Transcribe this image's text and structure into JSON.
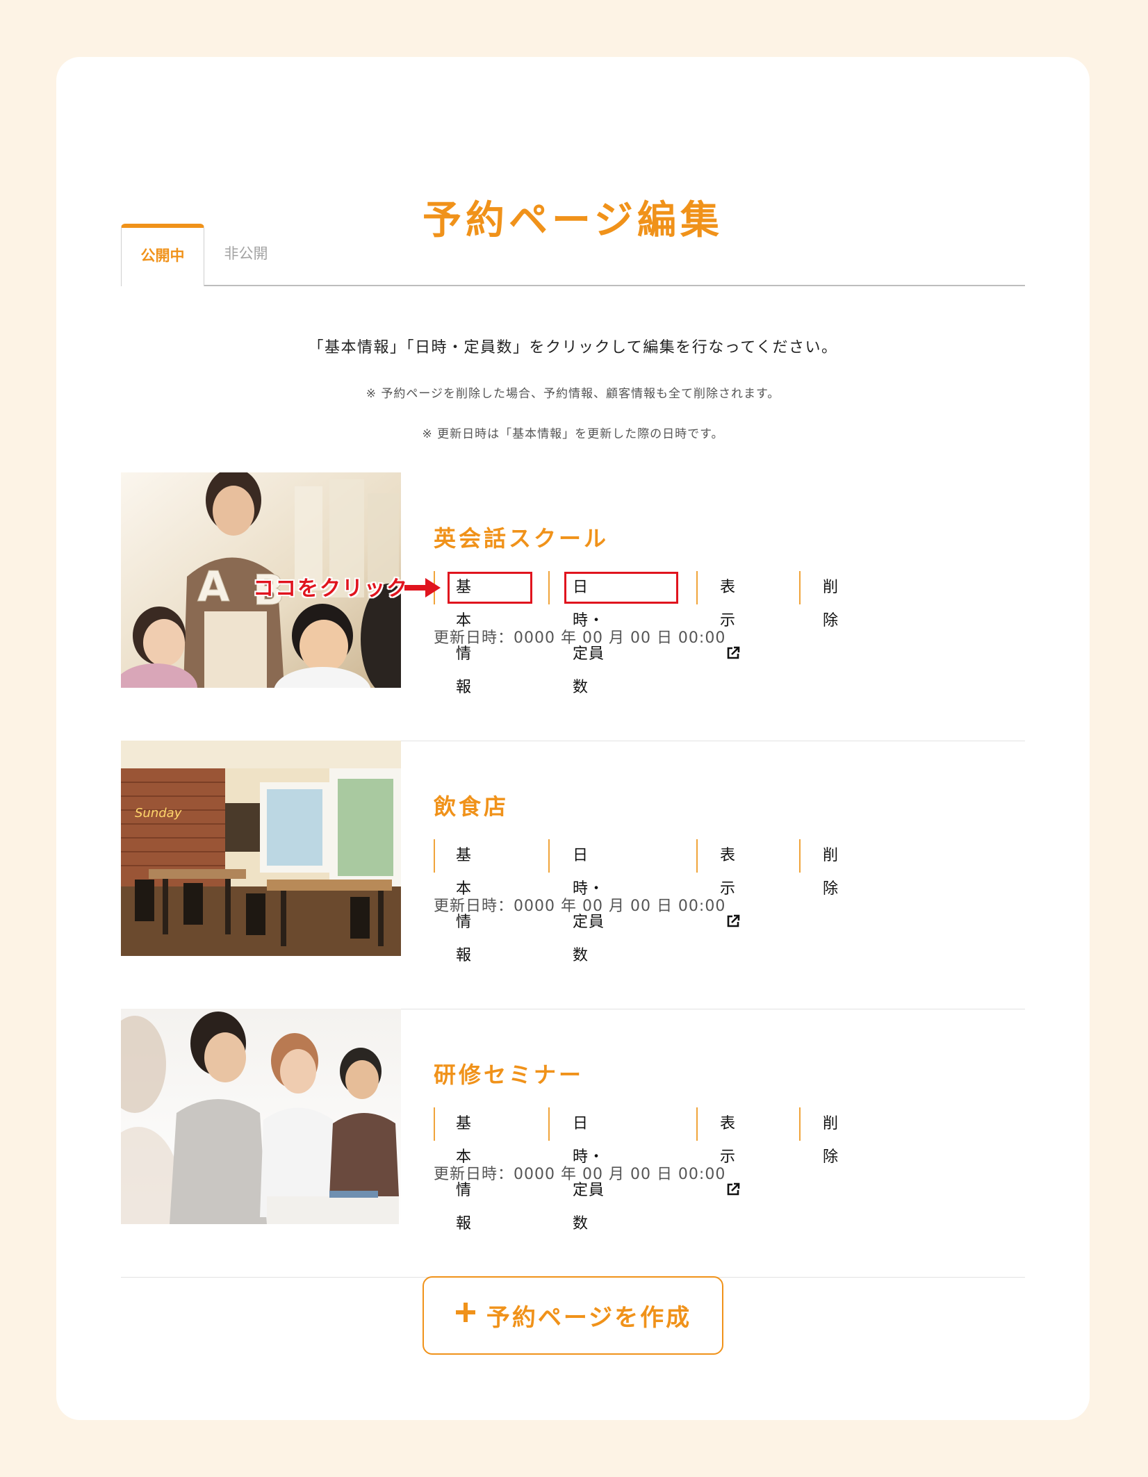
{
  "page_title": "予約ページ編集",
  "tabs": [
    {
      "label": "公開中",
      "active": true
    },
    {
      "label": "非公開",
      "active": false
    }
  ],
  "instructions": {
    "main": "「基本情報」「日時・定員数」をクリックして編集を行なってください。",
    "note1": "※ 予約ページを削除した場合、予約情報、顧客情報も全て削除されます。",
    "note2": "※ 更新日時は「基本情報」を更新した際の日時です。"
  },
  "actions": {
    "basic_info": "基本情報",
    "datetime_capacity": "日時・定員数",
    "view": "表示",
    "delete": "削除"
  },
  "items": [
    {
      "title": "英会話スクール",
      "updated": "更新日時：0000 年 00 月 00 日 00:00",
      "image": "english-school-photo"
    },
    {
      "title": "飲食店",
      "updated": "更新日時：0000 年 00 月 00 日 00:00",
      "image": "restaurant-photo"
    },
    {
      "title": "研修セミナー",
      "updated": "更新日時：0000 年 00 月 00 日 00:00",
      "image": "seminar-photo"
    }
  ],
  "annotation": {
    "label": "ココをクリック",
    "color": "#e0141e"
  },
  "create_button": {
    "label": "予約ページを作成",
    "icon": "plus-icon"
  },
  "colors": {
    "accent": "#f0921a",
    "background": "#fdf3e5",
    "card": "#ffffff"
  }
}
